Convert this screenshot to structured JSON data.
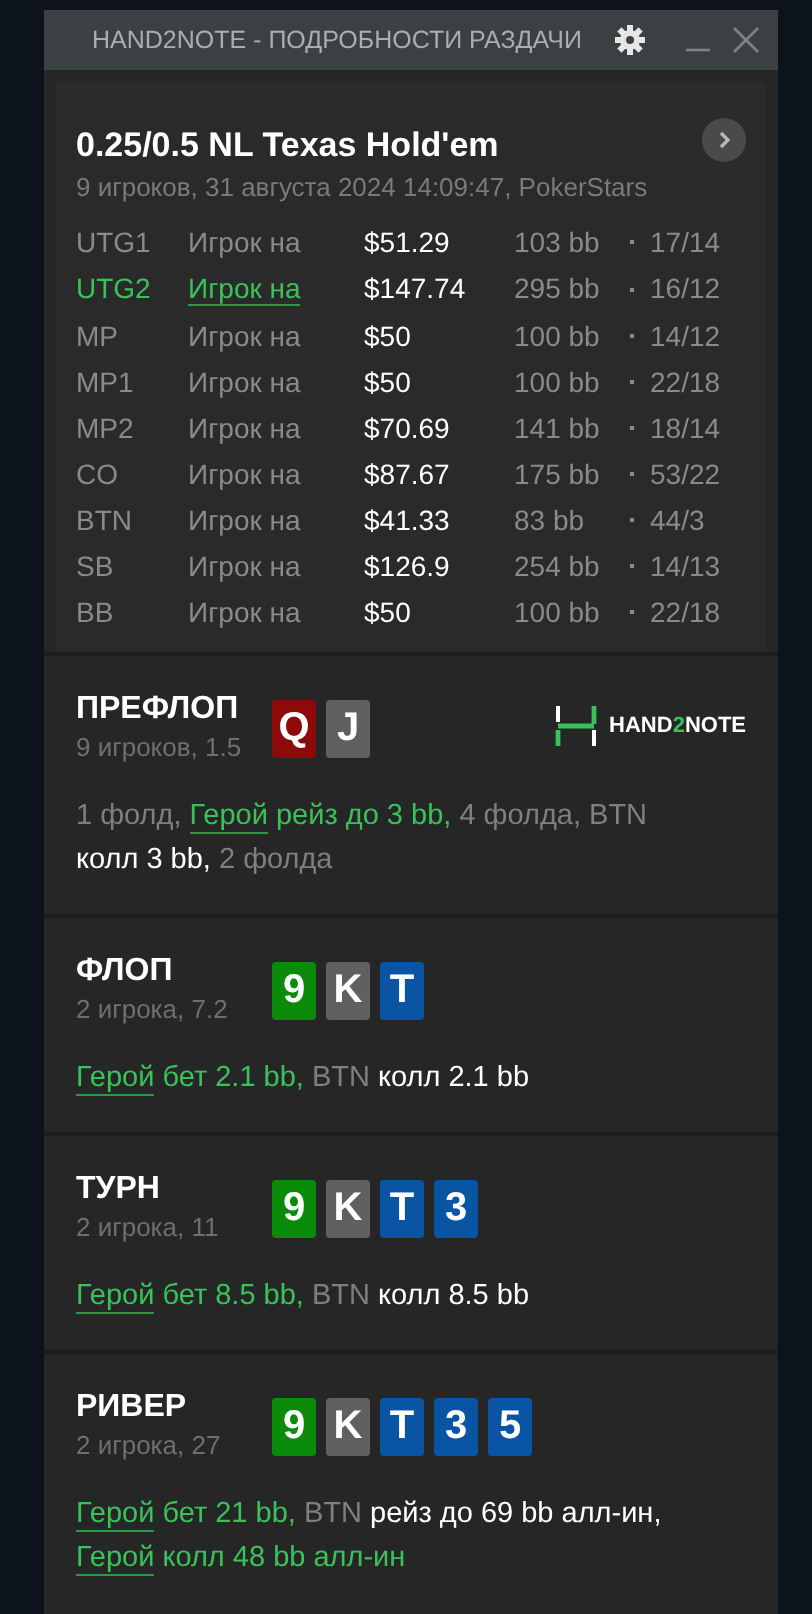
{
  "window": {
    "title": "HAND2NOTE - ПОДРОБНОСТИ РАЗДАЧИ"
  },
  "header": {
    "title": "0.25/0.5 NL Texas Hold'em",
    "subtitle": "9 игроков, 31 августа 2024 14:09:47, PokerStars"
  },
  "players": [
    {
      "position": "UTG1",
      "name": "Игрок на",
      "stack": "$51.29",
      "bb": "103 bb",
      "stats": "17/14",
      "selected": false
    },
    {
      "position": "UTG2",
      "name": "Игрок на",
      "stack": "$147.74",
      "bb": "295 bb",
      "stats": "16/12",
      "selected": true
    },
    {
      "position": "MP",
      "name": "Игрок на",
      "stack": "$50",
      "bb": "100 bb",
      "stats": "14/12",
      "selected": false
    },
    {
      "position": "MP1",
      "name": "Игрок на",
      "stack": "$50",
      "bb": "100 bb",
      "stats": "22/18",
      "selected": false
    },
    {
      "position": "MP2",
      "name": "Игрок на",
      "stack": "$70.69",
      "bb": "141 bb",
      "stats": "18/14",
      "selected": false
    },
    {
      "position": "CO",
      "name": "Игрок на",
      "stack": "$87.67",
      "bb": "175 bb",
      "stats": "53/22",
      "selected": false
    },
    {
      "position": "BTN",
      "name": "Игрок на",
      "stack": "$41.33",
      "bb": "83 bb",
      "stats": "44/3",
      "selected": false
    },
    {
      "position": "SB",
      "name": "Игрок на",
      "stack": "$126.9",
      "bb": "254 bb",
      "stats": "14/13",
      "selected": false
    },
    {
      "position": "BB",
      "name": "Игрок на",
      "stack": "$50",
      "bb": "100 bb",
      "stats": "22/18",
      "selected": false
    }
  ],
  "streets": [
    {
      "name": "ПРЕФЛОП",
      "info": "9 игроков, 1.5",
      "logo": {
        "prefix": "HAND",
        "accent": "2",
        "suffix": "NOTE"
      },
      "cards": [
        {
          "rank": "Q",
          "color": "#8c0a0a"
        },
        {
          "rank": "J",
          "color": "#606060"
        }
      ],
      "actions": [
        {
          "text": "1 фолд, ",
          "kind": "muted"
        },
        {
          "text": "Герой",
          "kind": "hero-name"
        },
        {
          "text": " рейз до 3 bb,",
          "kind": "hero"
        },
        {
          "text": " 4 фолда, BTN ",
          "kind": "muted"
        },
        {
          "text": "колл 3 bb,",
          "kind": "action"
        },
        {
          "text": " 2 фолда",
          "kind": "muted"
        }
      ]
    },
    {
      "name": "ФЛОП",
      "info": "2 игрока, 7.2",
      "cards": [
        {
          "rank": "9",
          "color": "#0a8c0a"
        },
        {
          "rank": "K",
          "color": "#606060"
        },
        {
          "rank": "T",
          "color": "#0a55a3"
        }
      ],
      "actions": [
        {
          "text": "Герой",
          "kind": "hero-name"
        },
        {
          "text": " бет 2.1 bb,",
          "kind": "hero"
        },
        {
          "text": " BTN ",
          "kind": "muted"
        },
        {
          "text": "колл 2.1 bb",
          "kind": "action"
        }
      ]
    },
    {
      "name": "ТУРН",
      "info": "2 игрока, 11",
      "cards": [
        {
          "rank": "9",
          "color": "#0a8c0a"
        },
        {
          "rank": "K",
          "color": "#606060"
        },
        {
          "rank": "T",
          "color": "#0a55a3"
        },
        {
          "rank": "3",
          "color": "#0a55a3"
        }
      ],
      "actions": [
        {
          "text": "Герой",
          "kind": "hero-name"
        },
        {
          "text": " бет 8.5 bb,",
          "kind": "hero"
        },
        {
          "text": " BTN ",
          "kind": "muted"
        },
        {
          "text": "колл 8.5 bb",
          "kind": "action"
        }
      ]
    },
    {
      "name": "РИВЕР",
      "info": "2 игрока, 27",
      "cards": [
        {
          "rank": "9",
          "color": "#0a8c0a"
        },
        {
          "rank": "K",
          "color": "#606060"
        },
        {
          "rank": "T",
          "color": "#0a55a3"
        },
        {
          "rank": "3",
          "color": "#0a55a3"
        },
        {
          "rank": "5",
          "color": "#0a55a3"
        }
      ],
      "actions": [
        {
          "text": "Герой",
          "kind": "hero-name"
        },
        {
          "text": " бет 21 bb,",
          "kind": "hero"
        },
        {
          "text": " BTN ",
          "kind": "muted"
        },
        {
          "text": "рейз до 69 bb алл-ин, ",
          "kind": "action"
        },
        {
          "text": "Герой",
          "kind": "hero-name"
        },
        {
          "text": " колл 48 bb алл-ин",
          "kind": "hero"
        }
      ]
    }
  ]
}
